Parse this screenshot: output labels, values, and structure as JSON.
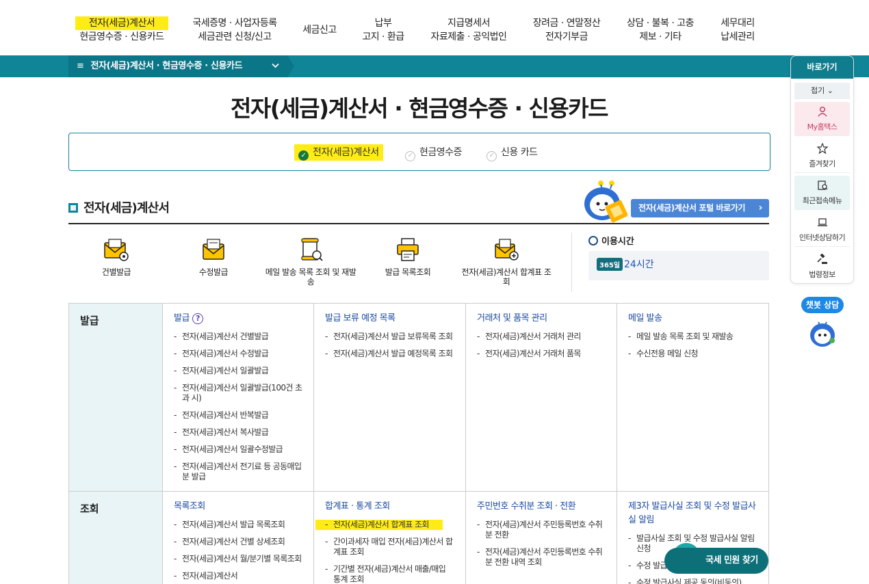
{
  "topnav": [
    {
      "l1": "전자(세금)계산서",
      "l2": "현금영수증 · 신용카드",
      "active": true
    },
    {
      "l1": "국세증명 · 사업자등록",
      "l2": "세금관련 신청/신고"
    },
    {
      "l1": "세금신고",
      "l2": ""
    },
    {
      "l1": "납부",
      "l2": "고지 · 환급"
    },
    {
      "l1": "지급명세서",
      "l2": "자료제출 · 공익법인"
    },
    {
      "l1": "장려금 · 연말정산",
      "l2": "전자기부금"
    },
    {
      "l1": "상담 · 불복 · 고충",
      "l2": "제보 · 기타"
    },
    {
      "l1": "세무대리",
      "l2": "납세관리"
    }
  ],
  "breadcrumb": {
    "menu_icon": "≡",
    "label": "전자(세금)계산서 · 현금영수증 · 신용카드",
    "chevron": "⌄"
  },
  "page_title": "전자(세금)계산서 · 현금영수증 · 신용카드",
  "tabs": [
    {
      "label": "전자(세금)계산서",
      "active": true
    },
    {
      "label": "현금영수증",
      "active": false
    },
    {
      "label": "신용 카드",
      "active": false
    }
  ],
  "section": {
    "title": "전자(세금)계산서",
    "portal_button": "전자(세금)계산서 포털 바로가기",
    "portal_arrow": "›"
  },
  "quick_menu": [
    {
      "label": "건별발급",
      "icon": "envelope-gear-icon"
    },
    {
      "label": "수정발급",
      "icon": "envelope-edit-icon"
    },
    {
      "label": "메일 발송 목록 조회 및 재발송",
      "icon": "scroll-search-icon"
    },
    {
      "label": "발급 목록조회",
      "icon": "printer-icon"
    },
    {
      "label": "전자(세금)계산서 합계표 조회",
      "icon": "envelope-plus-icon"
    }
  ],
  "usage": {
    "title": "이용시간",
    "badge": "365일",
    "hours": "24시간"
  },
  "grid": {
    "issue": {
      "head": "발급",
      "cols": [
        {
          "title": "발급",
          "help": "?",
          "items": [
            "전자(세금)계산서 건별발급",
            "전자(세금)계산서 수정발급",
            "전자(세금)계산서 일괄발급",
            "전자(세금)계산서 일괄발급(100건 초과 시)",
            "전자(세금)계산서 반복발급",
            "전자(세금)계산서 복사발급",
            "전자(세금)계산서 일괄수정발급",
            "전자(세금)계산서 전기료 등 공동매입분 발급"
          ]
        },
        {
          "title": "발급 보류 예정 목록",
          "items": [
            "전자(세금)계산서 발급 보류목록 조회",
            "전자(세금)계산서 발급 예정목록 조회"
          ]
        },
        {
          "title": "거래처 및 품목 관리",
          "items": [
            "전자(세금)계산서 거래처 관리",
            "전자(세금)계산서 거래처 품목"
          ]
        },
        {
          "title": "메일 발송",
          "items": [
            "메일 발송 목록 조회 및 재발송",
            "수신전용 메일 신청"
          ]
        }
      ]
    },
    "inquiry": {
      "head": "조회",
      "cols": [
        {
          "title": "목록조회",
          "items": [
            "전자(세금)계산서 발급 목록조회",
            "전자(세금)계산서 건별 상세조회",
            "전자(세금)계산서 월/분기별 목록조회",
            "전자(세금)계산서"
          ]
        },
        {
          "title": "합계표 · 통계 조회",
          "items": [
            "전자(세금)계산서 합계표 조회",
            "간이과세자 매입 전자(세금)계산서 합계표 조회",
            "기간별 전자(세금)계산서 매출/매입 통계 조회"
          ]
        },
        {
          "title": "주민번호 수취분 조회 · 전환",
          "items": [
            "전자(세금)계산서 주민등록번호 수취분 전환",
            "전자(세금)계산서 주민등록번호 수취분 전환 내역 조회"
          ]
        },
        {
          "title": "제3자 발급사실 조회 및 수정 발급사실 알림",
          "items": [
            "발급사실 조회 및 수정 발급사실 알림 신청",
            "수정 발급",
            "수정 발급사실 제공 동의(비동의)"
          ]
        }
      ]
    }
  },
  "right_panel": {
    "title": "바로가기",
    "fold": "접기 ⌄",
    "items": [
      {
        "label": "My홈택스",
        "icon": "person-icon"
      },
      {
        "label": "즐겨찾기",
        "icon": "star-icon"
      },
      {
        "label": "최근접속메뉴",
        "icon": "recent-menu-icon"
      },
      {
        "label": "인터넷상담하기",
        "icon": "laptop-icon"
      },
      {
        "label": "법령정보",
        "icon": "gavel-icon"
      }
    ]
  },
  "chatbot": {
    "label": "챗봇 상담"
  },
  "minwon": {
    "label": "국세 민원 찾기"
  },
  "colors": {
    "teal": "#0f8597",
    "highlight": "#ffec16",
    "link_blue": "#1b4aa0",
    "portal_blue": "#4b86d6"
  }
}
